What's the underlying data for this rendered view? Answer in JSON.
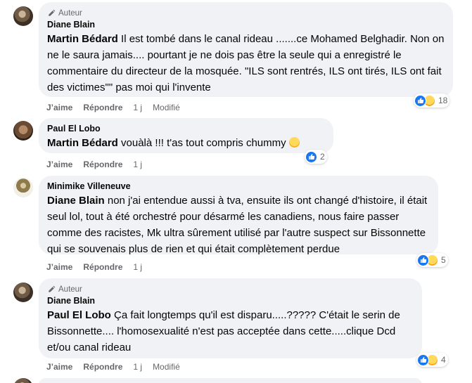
{
  "comments": [
    {
      "author_badge": "Auteur",
      "author": "Diane Blain",
      "mention": "Martin Bédard",
      "text": " Il est tombé dans le canal rideau .......ce Mohamed Belghadir. Non on ne le saura jamais.... pourtant je ne dois pas être la seule qui a enregistré le commentaire du directeur de la mosquée. \"ILS sont rentrés, ILS ont tirés, ILS ont fait des victimes\"\" pas moi qui l'invente",
      "like": "J’aime",
      "reply": "Répondre",
      "time": "1 j",
      "edited": "Modifié",
      "reaction_count": "18"
    },
    {
      "author": "Paul El Lobo",
      "mention": "Martin Bédard",
      "text": " vouàlà !!! t'as tout compris chummy ",
      "emoji_icon": "winking-face-icon",
      "like": "J’aime",
      "reply": "Répondre",
      "time": "1 j",
      "reaction_count": "2"
    },
    {
      "author": "Minimike Villeneuve",
      "mention": "Diane Blain",
      "text": " non j'ai entendue aussi à tva, ensuite ils ont changé d'histoire, il était seul lol, tout à été orchestré pour désarmé les canadiens, nous faire passer comme des racistes, Mk ultra sûrement utilisé par l'autre suspect sur Bissonnette qui se souvenais plus de rien et qui était complètement perdue",
      "like": "J’aime",
      "reply": "Répondre",
      "time": "1 j",
      "reaction_count": "5"
    },
    {
      "author_badge": "Auteur",
      "author": "Diane Blain",
      "mention": "Paul El Lobo",
      "text": " Ça fait longtemps qu'il est disparu.....????? C'était le serin de Bissonnette.... l'homosexualité n'est pas acceptée dans cette.....clique Dcd et/ou canal rideau",
      "like": "J’aime",
      "reply": "Répondre",
      "time": "1 j",
      "edited": "Modifié",
      "reaction_count": "4"
    }
  ],
  "colors": {
    "bubble": "#f0f2f5",
    "meta": "#65676b",
    "like_blue": "#1877f2"
  }
}
